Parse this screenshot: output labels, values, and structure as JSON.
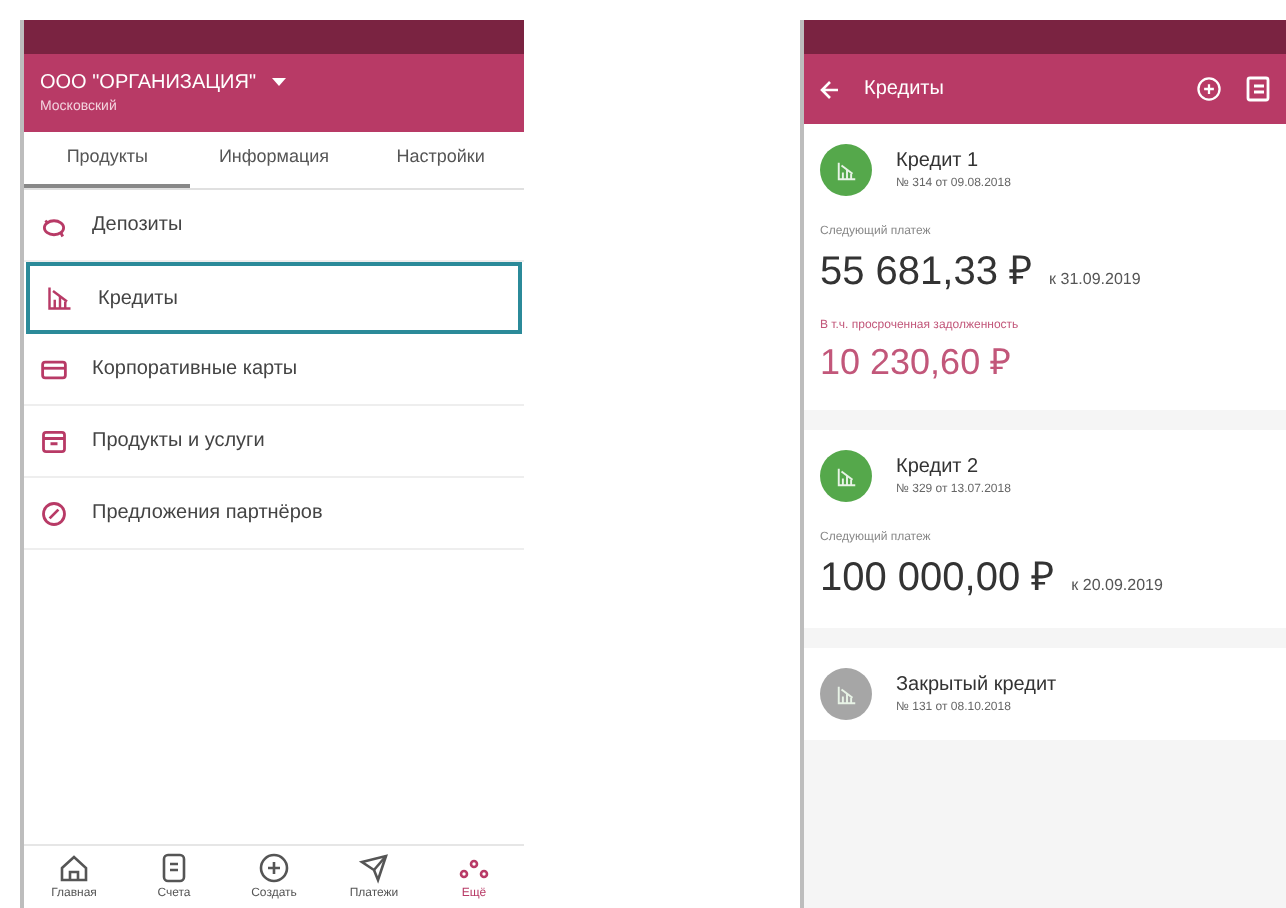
{
  "left_screen": {
    "org": {
      "name": "ООО \"ОРГАНИЗАЦИЯ\"",
      "subtitle": "Московский"
    },
    "tabs": [
      {
        "label": "Продукты",
        "selected": true
      },
      {
        "label": "Информация",
        "selected": false
      },
      {
        "label": "Настройки",
        "selected": false
      }
    ],
    "menu": [
      {
        "kind": "deposit",
        "label": "Депозиты",
        "selected": false
      },
      {
        "kind": "credit",
        "label": "Кредиты",
        "selected": true
      },
      {
        "kind": "card",
        "label": "Корпоративные карты",
        "selected": false
      },
      {
        "kind": "products",
        "label": "Продукты и услуги",
        "selected": false
      },
      {
        "kind": "offers",
        "label": "Предложения партнёров",
        "selected": false
      }
    ],
    "bottom_nav": [
      {
        "kind": "home",
        "label": "Главная",
        "selected": false
      },
      {
        "kind": "accounts",
        "label": "Счета",
        "selected": false
      },
      {
        "kind": "create",
        "label": "Создать",
        "selected": false
      },
      {
        "kind": "payments",
        "label": "Платежи",
        "selected": false
      },
      {
        "kind": "more",
        "label": "Ещё",
        "selected": true
      }
    ]
  },
  "right_screen": {
    "title": "Кредиты",
    "loans": [
      {
        "name": "Кредит 1",
        "number": "№ 314 от 09.08.2018",
        "closed": false,
        "next_label": "Следующий платеж",
        "next_amount": "55 681,33 ₽",
        "next_date": "к 31.09.2019",
        "overdue_label": "В т.ч. просроченная задолженность",
        "overdue_amount": "10 230,60 ₽"
      },
      {
        "name": "Кредит 2",
        "number": "№ 329 от 13.07.2018",
        "closed": false,
        "next_label": "Следующий платеж",
        "next_amount": "100 000,00 ₽",
        "next_date": "к 20.09.2019"
      },
      {
        "name": "Закрытый кредит",
        "number": "№ 131 от 08.10.2018",
        "closed": true
      }
    ]
  }
}
